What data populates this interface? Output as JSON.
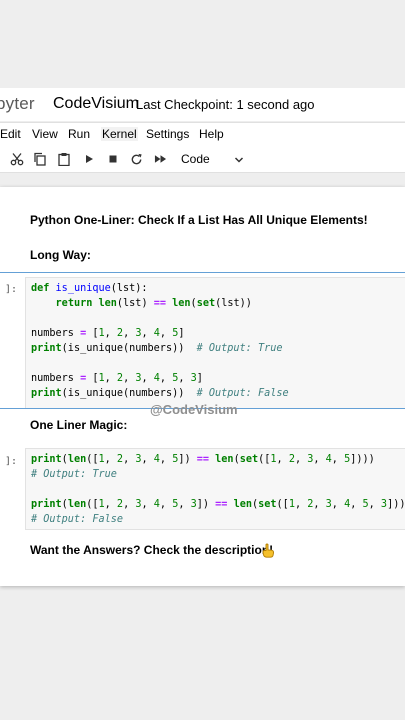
{
  "app": {
    "logo_text": "pyter",
    "notebook_title": "CodeVisium",
    "checkpoint": "Last Checkpoint: 1 second ago"
  },
  "menu": {
    "items": [
      {
        "label": "Edit"
      },
      {
        "label": "View"
      },
      {
        "label": "Run"
      },
      {
        "label": "Kernel"
      },
      {
        "label": "Settings"
      },
      {
        "label": "Help"
      }
    ]
  },
  "toolbar": {
    "buttons": [
      "cut-icon",
      "copy-icon",
      "paste-icon",
      "run-icon",
      "stop-icon",
      "restart-icon",
      "fast-forward-icon"
    ],
    "cell_type": "Code"
  },
  "cells": {
    "title": "Python One-Liner: Check If a List Has All Unique Elements!",
    "long_way_heading": "Long Way:",
    "prompt1": "]:",
    "code1": [
      "def is_unique(lst):",
      "    return len(lst) == len(set(lst))",
      "",
      "numbers = [1, 2, 3, 4, 5]",
      "print(is_unique(numbers))  # Output: True",
      "",
      "numbers = [1, 2, 3, 4, 5, 3]",
      "print(is_unique(numbers))  # Output: False"
    ],
    "one_liner_heading": "One Liner Magic:",
    "prompt2": "]:",
    "code2": [
      "print(len([1, 2, 3, 4, 5]) == len(set([1, 2, 3, 4, 5])))",
      "# Output: True",
      "",
      "print(len([1, 2, 3, 4, 5, 3]) == len(set([1, 2, 3, 4, 5, 3])))",
      "# Output: False"
    ],
    "footer_text": "Want the Answers? Check the description!"
  },
  "watermark": "@CodeVisium",
  "colors": {
    "selection": "#64a0d6",
    "keyword": "#008000",
    "operator": "#aa22ff",
    "comment": "#408080"
  }
}
